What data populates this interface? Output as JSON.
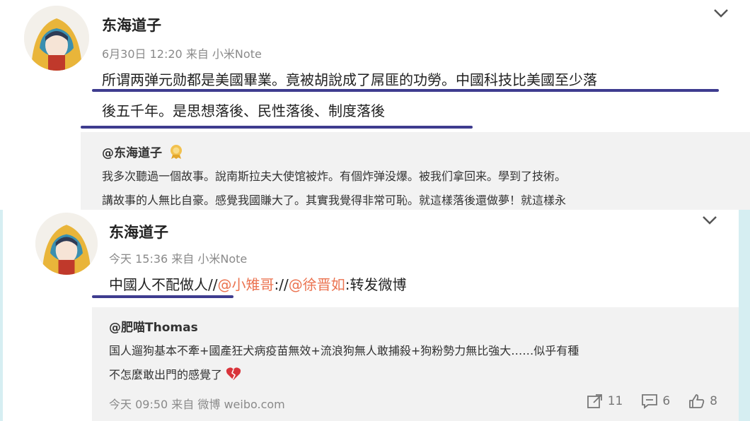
{
  "post1": {
    "username": "东海道子",
    "date": "6月30日 12:20",
    "via": "来自 小米Note",
    "text_line1": "所谓两弹元勋都是美國畢業。竟被胡說成了屌匪的功勞。中國科技比美國至少落",
    "text_line2": "後五千年。是思想落後、民性落後、制度落後",
    "repost": {
      "author": "@东海道子",
      "line1": "我多次聽過一個故事。說南斯拉夫大使馆被炸。有個炸弹没爆。被我们拿回来。學到了技術。",
      "line2": "講故事的人無比自豪。感覺我國賺大了。其實我覺得非常可恥。就這樣落後還做夢！就這樣永"
    }
  },
  "post2": {
    "username": "东海道子",
    "date": "今天 15:36",
    "via": "来自 小米Note",
    "text_main": "中國人不配做人//",
    "mention1": "@小雉哥",
    "sep": "://",
    "mention2": "@徐晋如",
    "text_tail": ":转发微博",
    "repost": {
      "author": "@肥喵Thomas",
      "line1": "国人遛狗基本不牽+國產狂犬病疫苗無效+流浪狗無人敢捕殺+狗粉勢力無比強大……似乎有種",
      "line2": "不怎麼敢出門的感覺了",
      "time": "今天 09:50",
      "via": "来自 微博 weibo.com",
      "reposts": "11",
      "comments": "6",
      "likes": "8"
    }
  },
  "colors": {
    "underline": "#3e3c8f",
    "link": "#eb7350",
    "meta": "#8a8a8a",
    "repost_bg": "#f2f2f2",
    "frame": "#d6eef2"
  },
  "icons": [
    "chevron-down-icon",
    "vip-badge-icon",
    "broken-heart-icon",
    "repost-icon",
    "comment-icon",
    "like-icon"
  ]
}
